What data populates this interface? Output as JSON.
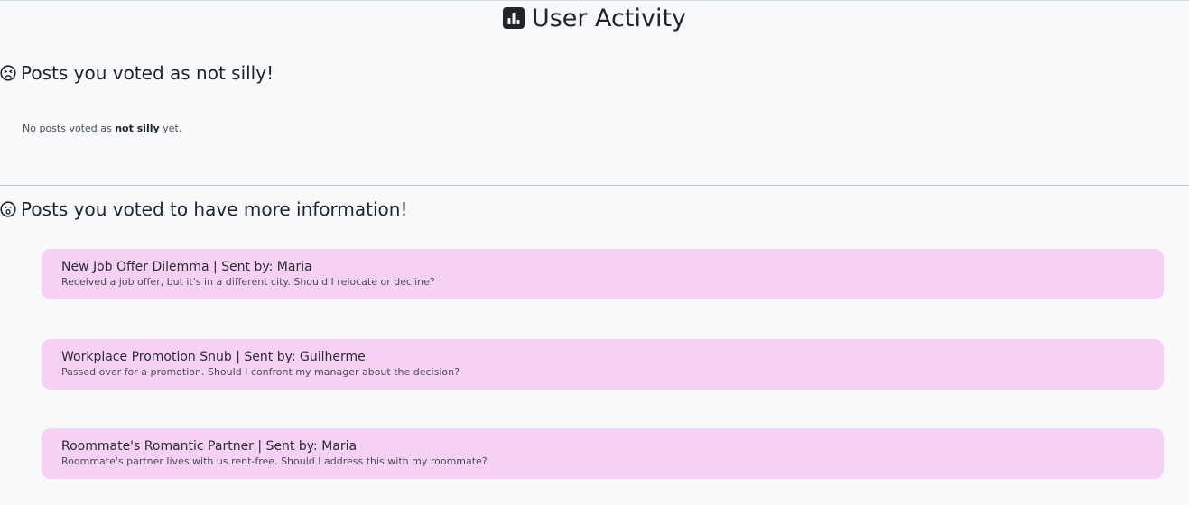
{
  "page": {
    "title": "User Activity",
    "title_icon": "bar-chart-square-icon"
  },
  "not_silly": {
    "heading": "Posts you voted as not silly!",
    "icon": "frowning-face-icon",
    "empty_prefix": "No posts voted as ",
    "empty_emphasis": "not silly",
    "empty_suffix": " yet."
  },
  "more_info": {
    "heading": "Posts you voted to have more information!",
    "icon": "surprised-face-icon",
    "posts": [
      {
        "title": "New Job Offer Dilemma | Sent by: Maria",
        "description": "Received a job offer, but it's in a different city. Should I relocate or decline?"
      },
      {
        "title": "Workplace Promotion Snub | Sent by: Guilherme",
        "description": "Passed over for a promotion. Should I confront my manager about the decision?"
      },
      {
        "title": "Roommate's Romantic Partner | Sent by: Maria",
        "description": "Roommate's partner lives with us rent-free. Should I address this with my roommate?"
      }
    ]
  },
  "colors": {
    "background": "#f8f9fa",
    "card": "#f7d0f5",
    "text": "#212529"
  }
}
